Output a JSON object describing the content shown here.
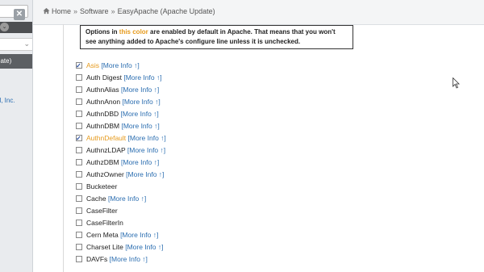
{
  "sidebar": {
    "search_clear": "✕",
    "dropdown_chevron": "⌄",
    "select_chevron": "⌄",
    "active_item_label": "date)",
    "link_label": "el, Inc."
  },
  "breadcrumb": {
    "home": "Home",
    "separator": "»",
    "software": "Software",
    "current": "EasyApache (Apache Update)"
  },
  "notice": {
    "part1": "Options in ",
    "highlight": "this color",
    "part2": " are enabled by default in Apache. That means that you won't see anything added to Apache's configure line unless it is unchecked."
  },
  "options": [
    {
      "name": "Asis",
      "more": "[More Info ↑]",
      "checked": true,
      "default": true
    },
    {
      "name": "Auth Digest",
      "more": "[More Info ↑]",
      "checked": false,
      "default": false
    },
    {
      "name": "AuthnAlias",
      "more": "[More Info ↑]",
      "checked": false,
      "default": false
    },
    {
      "name": "AuthnAnon",
      "more": "[More Info ↑]",
      "checked": false,
      "default": false
    },
    {
      "name": "AuthnDBD",
      "more": "[More Info ↑]",
      "checked": false,
      "default": false
    },
    {
      "name": "AuthnDBM",
      "more": "[More Info ↑]",
      "checked": false,
      "default": false
    },
    {
      "name": "AuthnDefault",
      "more": "[More Info ↑]",
      "checked": true,
      "default": true
    },
    {
      "name": "AuthnzLDAP",
      "more": "[More Info ↑]",
      "checked": false,
      "default": false
    },
    {
      "name": "AuthzDBM",
      "more": "[More Info ↑]",
      "checked": false,
      "default": false
    },
    {
      "name": "AuthzOwner",
      "more": "[More Info ↑]",
      "checked": false,
      "default": false
    },
    {
      "name": "Bucketeer",
      "more": "",
      "checked": false,
      "default": false
    },
    {
      "name": "Cache",
      "more": "[More Info ↑]",
      "checked": false,
      "default": false
    },
    {
      "name": "CaseFilter",
      "more": "",
      "checked": false,
      "default": false
    },
    {
      "name": "CaseFilterIn",
      "more": "",
      "checked": false,
      "default": false
    },
    {
      "name": "Cern Meta",
      "more": "[More Info ↑]",
      "checked": false,
      "default": false
    },
    {
      "name": "Charset Lite",
      "more": "[More Info ↑]",
      "checked": false,
      "default": false
    },
    {
      "name": "DAVFs",
      "more": "[More Info ↑]",
      "checked": false,
      "default": false
    }
  ],
  "colors": {
    "default_option": "#e69a1c",
    "link": "#2a6db0",
    "sidebar_active": "#5c5f63"
  }
}
